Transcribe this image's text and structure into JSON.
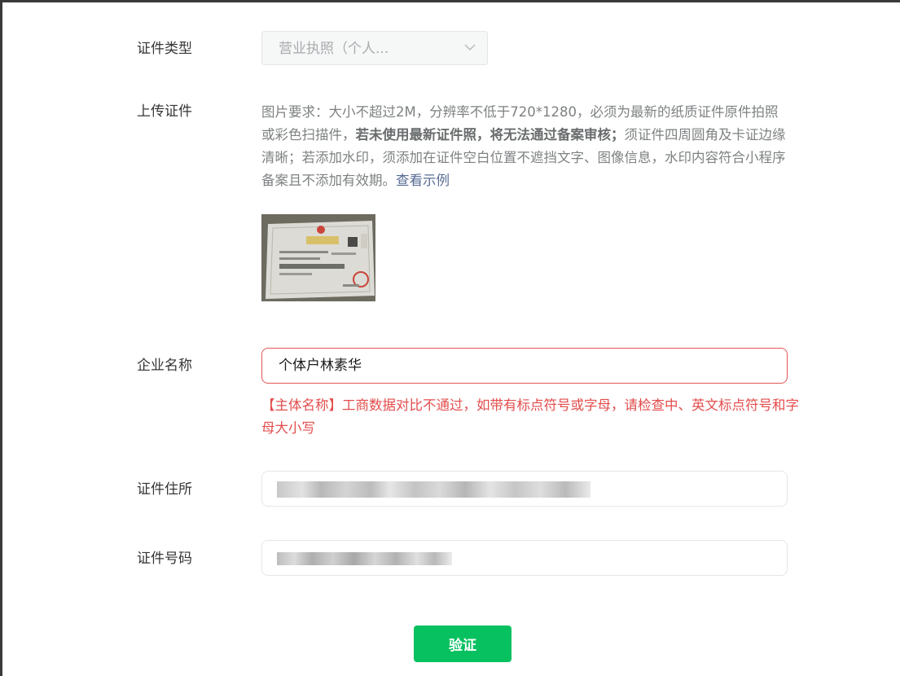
{
  "form": {
    "cert_type": {
      "label": "证件类型",
      "value": "营业执照（个人..."
    },
    "upload": {
      "label": "上传证件",
      "desc_part1": "图片要求：大小不超过2M，分辨率不低于720*1280，必须为最新的纸质证件原件拍照或彩色扫描件，",
      "desc_bold": "若未使用最新证件照，将无法通过备案审核；",
      "desc_part2": "须证件四周圆角及卡证边缘清晰；若添加水印，须添加在证件空白位置不遮挡文字、图像信息，水印内容符合小程序备案且不添加有效期。",
      "example_link": "查看示例"
    },
    "company_name": {
      "label": "企业名称",
      "value": "个体户林素华",
      "error": "【主体名称】工商数据对比不通过，如带有标点符号或字母，请检查中、英文标点符号和字母大小写"
    },
    "address": {
      "label": "证件住所"
    },
    "id_number": {
      "label": "证件号码"
    }
  },
  "verify_button": "验证",
  "colors": {
    "primary": "#07c160",
    "error": "#e34d4d",
    "link": "#576b95"
  },
  "icons": {
    "select_arrow": "chevron-down-icon"
  }
}
